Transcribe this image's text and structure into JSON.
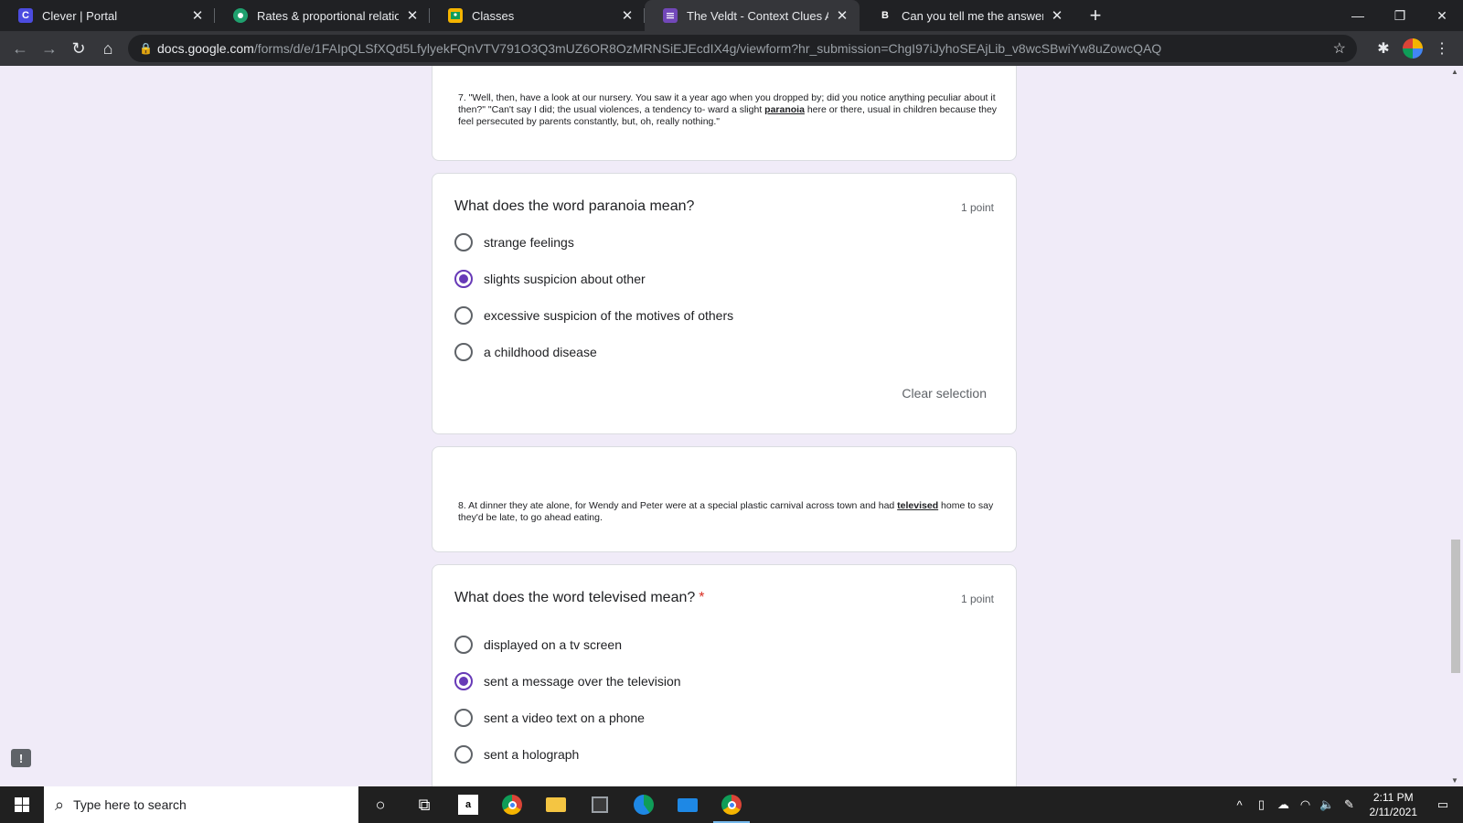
{
  "browser": {
    "tabs": [
      {
        "title": "Clever | Portal",
        "favicon": "C",
        "color": "#4c4ce0"
      },
      {
        "title": "Rates & proportional relationship",
        "favicon": "",
        "color": "#1fa06e"
      },
      {
        "title": "Classes",
        "favicon": "",
        "color": "#f4b400"
      },
      {
        "title": "The Veldt - Context Clues Activity",
        "favicon": "",
        "color": "#7248b9"
      },
      {
        "title": "Can you tell me the answer two t",
        "favicon": "B",
        "color": "#202124"
      }
    ],
    "address": {
      "host": "docs.google.com",
      "path": "/forms/d/e/1FAIpQLSfXQd5LfylyekFQnVTV791O3Q3mUZ6OR8OzMRNSiEJEcdIX4g/viewform?hr_submission=ChgI97iJyhoSEAjLib_v8wcSBwiYw8uZowcQAQ"
    }
  },
  "form": {
    "passage7": "7. \"Well, then, have a look at our nursery. You saw it a year ago when you dropped by; did you notice anything peculiar about it then?\" \"Can't say I did; the usual violences, a tendency to- ward a slight",
    "passage7_bold": "paranoia",
    "passage7_end": "here or there, usual in children because they feel persecuted by parents constantly, but, oh, really nothing.\"",
    "q1": {
      "title": "What does the word paranoia mean?",
      "points": "1 point",
      "options": [
        "strange feelings",
        "slights suspicion about other",
        "excessive suspicion of the motives of others",
        "a childhood disease"
      ],
      "selected_index": 1,
      "clear_label": "Clear selection"
    },
    "passage8": "8. At dinner they ate alone, for Wendy and Peter were at a special plastic carnival across town and had",
    "passage8_bold": "televised",
    "passage8_end": "home to say they'd be late, to go ahead eating.",
    "q2": {
      "title": "What does the word televised mean?",
      "required_mark": "*",
      "points": "1 point",
      "options": [
        "displayed on a tv screen",
        "sent a message over the television",
        "sent a video text on a phone",
        "sent a holograph"
      ],
      "selected_index": 1
    }
  },
  "taskbar": {
    "search_placeholder": "Type here to search",
    "time": "2:11 PM",
    "date": "2/11/2021"
  }
}
